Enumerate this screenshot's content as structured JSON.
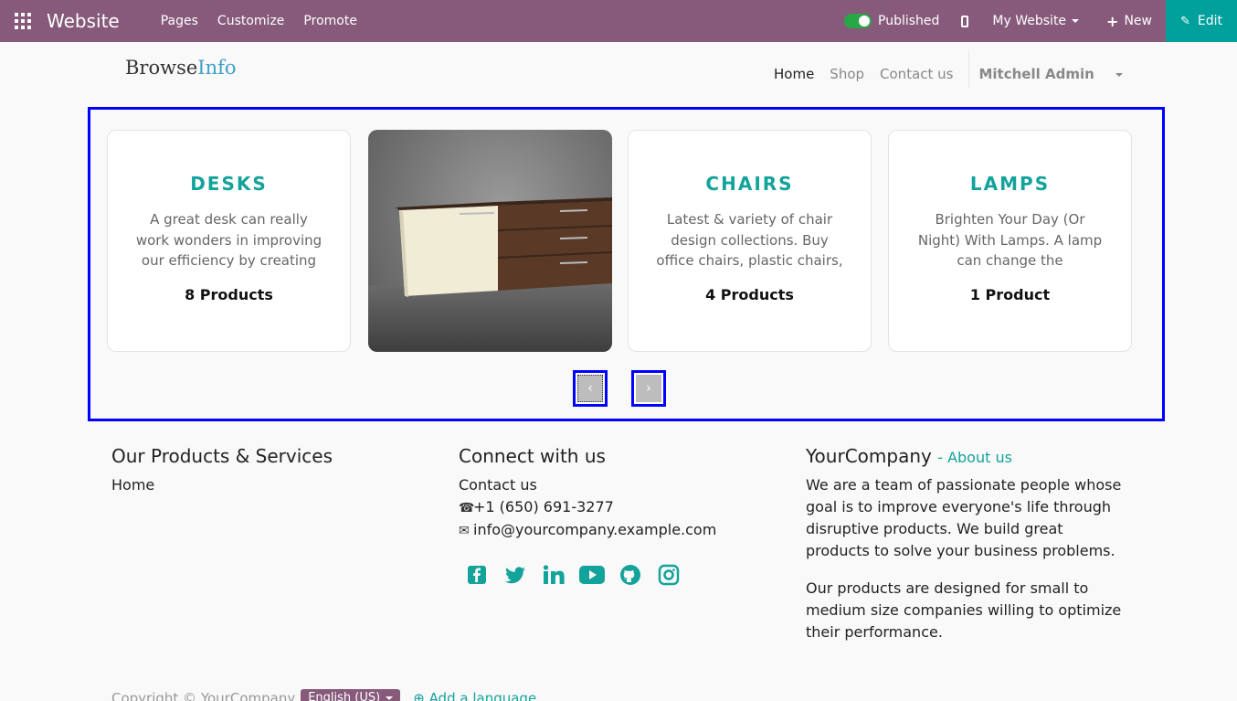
{
  "adminbar": {
    "title": "Website",
    "menu": [
      "Pages",
      "Customize",
      "Promote"
    ],
    "published_label": "Published",
    "website_select": "My Website",
    "new_label": "New",
    "edit_label": "Edit",
    "color": "#875a7b",
    "edit_color": "#00a09d"
  },
  "site": {
    "logo_part1": "Browse",
    "logo_part2": "Info",
    "nav": [
      "Home",
      "Shop",
      "Contact us"
    ],
    "user": "Mitchell Admin"
  },
  "carousel": {
    "cards": [
      {
        "title": "DESKS",
        "desc": "A great desk can really work wonders in improving our efficiency by creating",
        "count": "8 Products"
      },
      {
        "title": "CHAIRS",
        "desc": "Latest & variety of chair design collections. Buy office chairs, plastic chairs,",
        "count": "4 Products"
      },
      {
        "title": "LAMPS",
        "desc": "Brighten Your Day (Or Night) With Lamps. A lamp can change the",
        "count": "1 Product"
      }
    ],
    "accent": "#13a39b"
  },
  "footer": {
    "products_title": "Our Products & Services",
    "products_link": "Home",
    "connect_title": "Connect with us",
    "contact_link": "Contact us",
    "phone": "+1 (650) 691-3277",
    "email": "info@yourcompany.example.com",
    "social_icons": [
      "facebook-icon",
      "twitter-icon",
      "linkedin-icon",
      "youtube-icon",
      "github-icon",
      "instagram-icon"
    ],
    "company": "YourCompany",
    "about_link": "About us",
    "about_p1": "We are a team of passionate people whose goal is to improve everyone's life through disruptive products. We build great products to solve your business problems.",
    "about_p2": "Our products are designed for small to medium size companies willing to optimize their performance.",
    "copyright": "Copyright © YourCompany",
    "language": "English (US)",
    "add_language": "Add a language"
  }
}
